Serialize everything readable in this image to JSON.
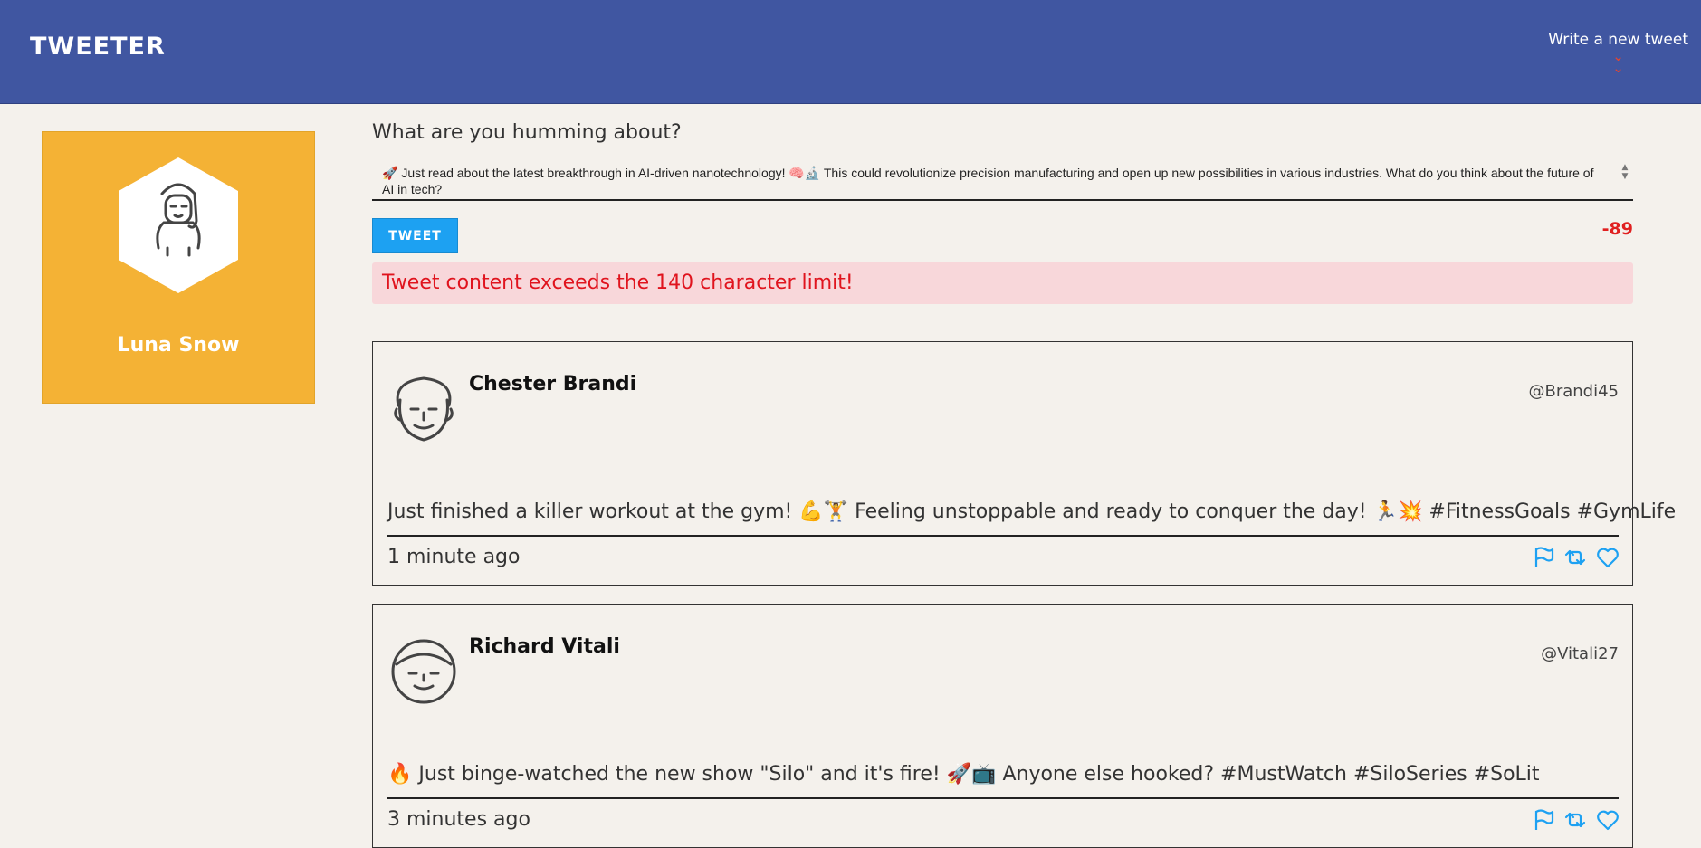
{
  "header": {
    "logo": "TWEETER",
    "write_link": "Write a new tweet"
  },
  "profile": {
    "name": "Luna Snow"
  },
  "composer": {
    "prompt": "What are you humming about?",
    "value": "🚀 Just read about the latest breakthrough in AI-driven nanotechnology! 🧠🔬 This could revolutionize precision manufacturing and open up new possibilities in various industries. What do you think about the future of AI in tech?",
    "button_label": "TWEET",
    "counter": "-89",
    "error": "Tweet content exceeds the 140 character limit!"
  },
  "tweets": [
    {
      "name": "Chester Brandi",
      "handle": "@Brandi45",
      "text": "Just finished a killer workout at the gym! 💪🏋 Feeling unstoppable and ready to conquer the day! 🏃💥 #FitnessGoals #GymLife",
      "time": "1 minute ago"
    },
    {
      "name": "Richard Vitali",
      "handle": "@Vitali27",
      "text": "🔥 Just binge-watched the new show \"Silo\" and it's fire! 🚀📺 Anyone else hooked? #MustWatch #SiloSeries #SoLit",
      "time": "3 minutes ago"
    }
  ],
  "colors": {
    "header_bg": "#4056a1",
    "profile_bg": "#f4b235",
    "tweet_button": "#1da1f2",
    "error_text": "#e0141e",
    "error_bg": "#f8d7da",
    "action_icons": "#1da1f2"
  },
  "icons": {
    "write_chevron": "double-chevron-down-icon",
    "flag": "flag-icon",
    "retweet": "retweet-icon",
    "like": "heart-icon"
  }
}
